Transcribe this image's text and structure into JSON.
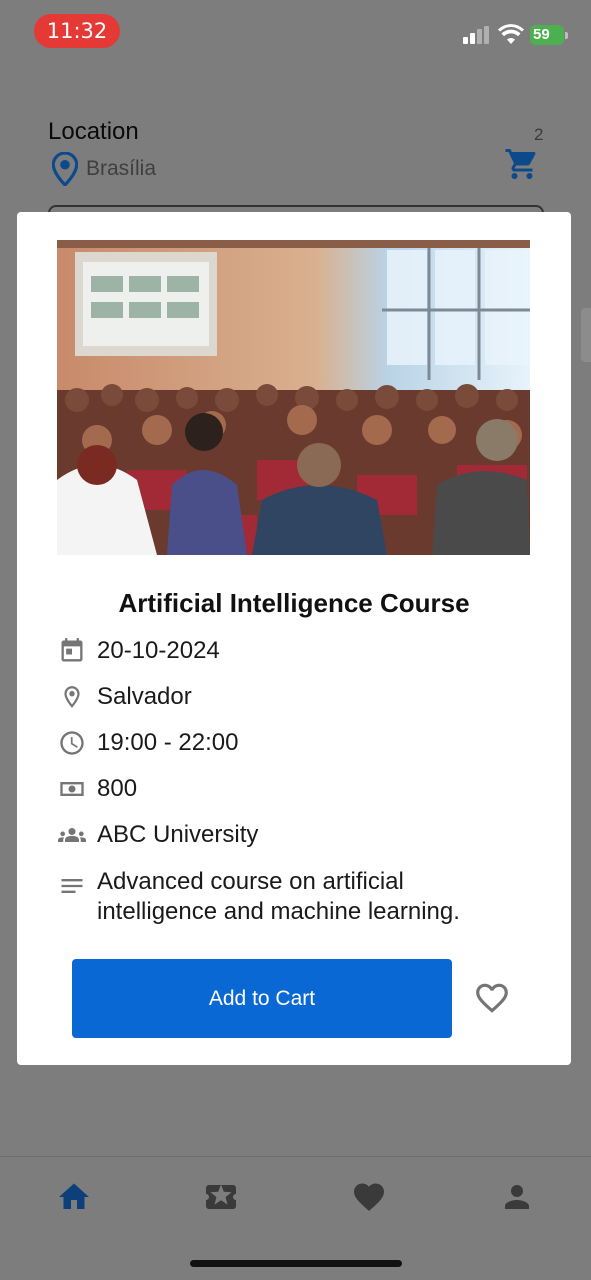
{
  "status_bar": {
    "time": "11:32",
    "battery": "59"
  },
  "header": {
    "location_label": "Location",
    "city": "Brasília",
    "cart_count": "2"
  },
  "event": {
    "title": "Artificial Intelligence Course",
    "date": "20-10-2024",
    "city": "Salvador",
    "time_range": "19:00 - 22:00",
    "price": "800",
    "organizer": "ABC University",
    "description_line1": "Advanced course on artificial",
    "description_line2": "intelligence and machine learning."
  },
  "actions": {
    "add_to_cart": "Add to Cart"
  },
  "icons": {
    "date": "calendar-icon",
    "place": "location-pin-icon",
    "time": "clock-icon",
    "price": "money-icon",
    "organizer": "group-icon",
    "description": "notes-icon",
    "favorite": "heart-outline-icon",
    "cart": "cart-icon"
  },
  "bottom_nav": [
    "home-icon",
    "ticket-icon",
    "heart-icon",
    "person-icon"
  ],
  "colors": {
    "accent": "#0a68d4",
    "dark_blue": "#0d4a8c",
    "overlay": "#7d7d7d",
    "time_pill": "#e53935",
    "battery": "#4caf50"
  }
}
